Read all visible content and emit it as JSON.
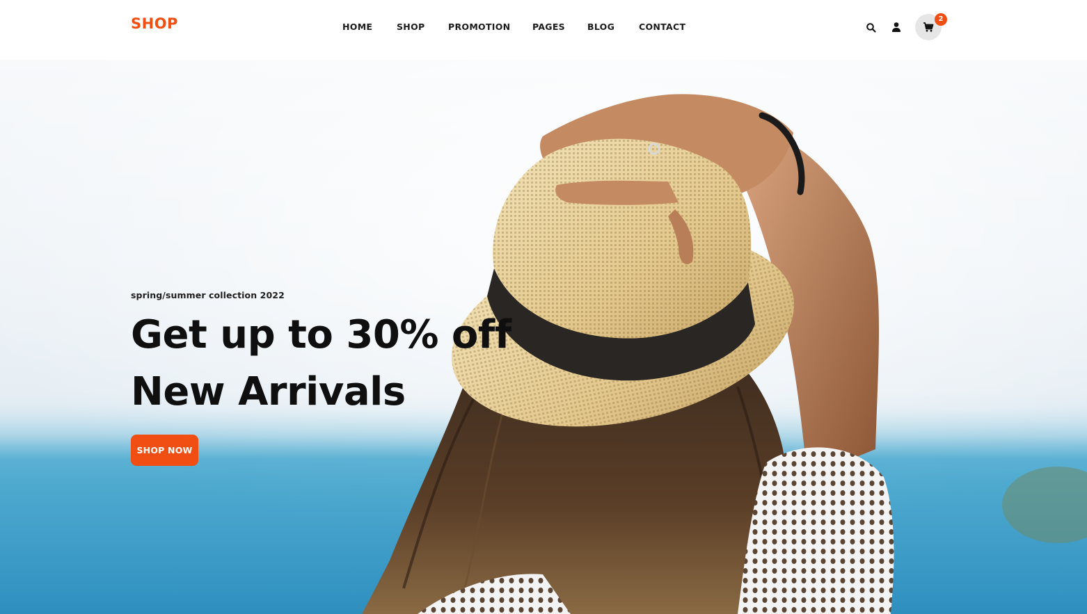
{
  "brand": {
    "logo_text": "SHOP",
    "accent_color": "#f04e12"
  },
  "nav": {
    "items": [
      {
        "label": "HOME"
      },
      {
        "label": "SHOP"
      },
      {
        "label": "PROMOTION"
      },
      {
        "label": "PAGES"
      },
      {
        "label": "BLOG"
      },
      {
        "label": "CONTACT"
      }
    ]
  },
  "header_icons": {
    "search": "search-icon",
    "account": "user-icon",
    "cart": "cart-icon",
    "cart_count": "2"
  },
  "hero": {
    "subtitle": "spring/summer collection 2022",
    "title_line1": "Get up to 30% off",
    "title_line2": "New Arrivals",
    "cta_label": "SHOP NOW",
    "image": "woman-in-straw-hat-by-sea"
  }
}
